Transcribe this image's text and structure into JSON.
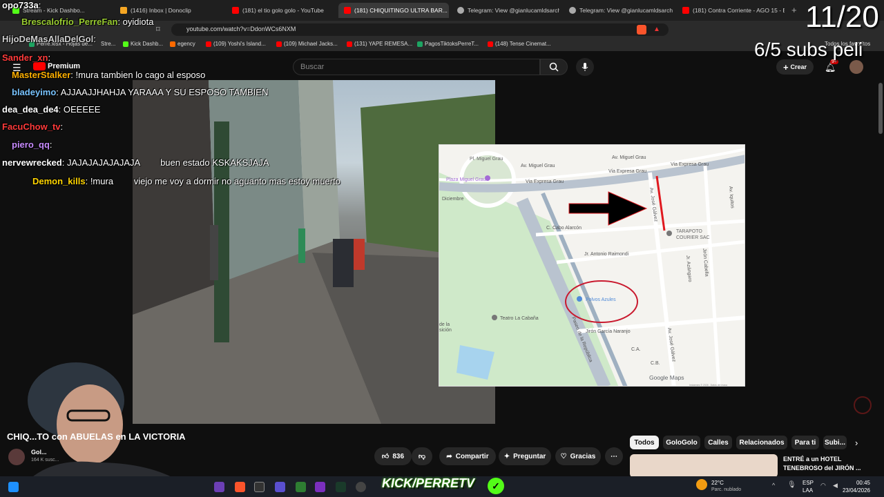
{
  "browser": {
    "tabs": [
      {
        "label": "Stream - Kick Dashbo..."
      },
      {
        "label": "(1416) Inbox | Donoclip"
      },
      {
        "label": "(181) el tio golo golo - YouTube"
      },
      {
        "label": "(181) CHIQUITINGO ULTRA BAR..."
      },
      {
        "label": "Telegram: View @gianlucamldsarchi..."
      },
      {
        "label": "Telegram: View @gianlucamldsarchi..."
      },
      {
        "label": "(181) Contra Corriente - AGO 15 - E..."
      }
    ],
    "url": "youtube.com/watch?v=DdonWCs6NXM",
    "bookmarks": [
      {
        "label": "Perre.xlsx - Hojas de..."
      },
      {
        "label": "Stre..."
      },
      {
        "label": "Kick Dashb..."
      },
      {
        "label": "egency"
      },
      {
        "label": "(109) Yoshi's Island..."
      },
      {
        "label": "(109) Michael Jacks..."
      },
      {
        "label": "(131) YAPE REMESA..."
      },
      {
        "label": "PagosTiktoksPerreT..."
      },
      {
        "label": "(148) Tense Cinemat..."
      }
    ],
    "all_bookmarks": "Todos los favoritos"
  },
  "youtube": {
    "premium": "Premium",
    "search_placeholder": "Buscar",
    "create": "Crear",
    "notif_badge": "9+",
    "video_title": "CHIQ...TO con ABUELAS en LA VICTORIA",
    "channel_short": "Gol...",
    "subs_short": "164 K susc...",
    "likes": "836",
    "share": "Compartir",
    "ask": "Preguntar",
    "thanks": "Gracias",
    "chips": [
      "Todos",
      "GoloGolo",
      "Calles",
      "Relacionados",
      "Para ti",
      "Subi..."
    ],
    "rec_title_1": "ENTRÉ a un HOTEL",
    "rec_title_2": "TENEBROSO del JIRÓN ..."
  },
  "map": {
    "labels": {
      "pl_grau": "Pl. Miguel Grau",
      "av_grau_1": "Av. Miguel Grau",
      "av_grau_2": "Av. Miguel Grau",
      "via_expresa_1": "Via Expresa Grau",
      "via_expresa_2": "Via Expresa Grau",
      "via_expresa_3": "Via Expresa Grau",
      "plaza_grau": "Plaza Miguel Grau",
      "diciembre": "Diciembre",
      "alarcon": "C. Cabo Alarcón",
      "raimondi": "Jr. Antonio Raimondi",
      "tarapoto_1": "TARAPOTO",
      "tarapoto_2": "COURIER SAC",
      "polvos": "Polvos Azules",
      "teatro": "Teatro La Cabaña",
      "naranjo": "Jirón García Naranjo",
      "republica": "Paseo de la República",
      "jose_galvez": "Av. José Gálvez",
      "jose_galvez_2": "Av. José Gálvez",
      "azangaro": "Jr. Azángaro",
      "cabella": "Jirón Cabella",
      "iquitos": "Av. Iquitos",
      "ca": "C.A.",
      "cb": "C.B.",
      "de_la": "de la",
      "sicion": "sición",
      "google": "Google Maps",
      "credit": "Imágenes © 2026 , Datos del mapa"
    }
  },
  "overlay": {
    "counter": "11/20",
    "subs_goal": "6/5 subs peli",
    "kick": "KICK/PERRETV",
    "chat": [
      {
        "name": "opo733a",
        "msg": ":",
        "color": "#ffffff"
      },
      {
        "name": "Brescalofrio_PerreFan",
        "msg": ": oyidiota",
        "color": "#9acd32"
      },
      {
        "name": "HijoDeMasAllaDelGol",
        "msg": ":",
        "color": "#cfcfcf"
      },
      {
        "name": "Sander_xn",
        "msg": ":",
        "color": "#ff3b3b"
      },
      {
        "name": "MasterStalker",
        "msg": ": !mura tambien lo cago al esposo",
        "color": "#ffb000"
      },
      {
        "name": "bladeyimo",
        "msg": ": AJJAAJJHAHJA YARAAA Y SU ESPOSO TAMBIEN",
        "color": "#79c4ff"
      },
      {
        "name": "dea_dea_de4",
        "msg": ": OEEEEE",
        "color": "#ffffff"
      },
      {
        "name": "FacuChow_tv",
        "msg": ":",
        "color": "#ff3b3b"
      },
      {
        "name": "piero_qq",
        "msg": ":",
        "color": "#c88cff"
      },
      {
        "name": "nervewrecked",
        "msg": ": JAJAJAJAJAJAJA",
        "color": "#ffffff"
      },
      {
        "name": "Demon_kills",
        "msg": ": !mura",
        "color": "#ffd400"
      }
    ],
    "chat_extra_1": "buen estado KSKAKSJAJA",
    "chat_extra_2": "viejo me voy a dormir no aguanto mas estoy muerto"
  },
  "taskbar": {
    "temp": "22°C",
    "weather": "Parc. nublado",
    "lang_1": "ESP",
    "lang_2": "LAA",
    "time": "00:45",
    "date": "23/04/2026"
  }
}
